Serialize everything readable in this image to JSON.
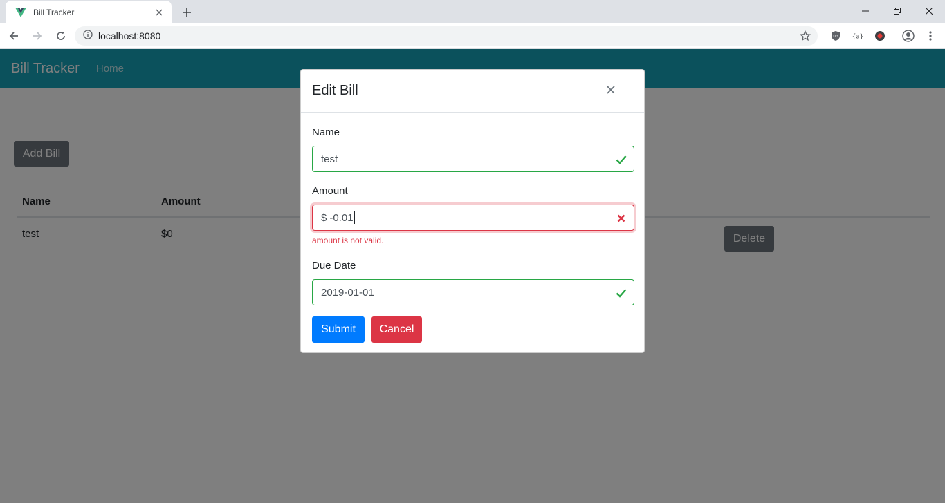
{
  "browser": {
    "tab_title": "Bill Tracker",
    "favicon_icon": "vue-logo-icon",
    "url": "localhost:8080",
    "extensions": [
      "ublock-icon",
      "json-formatter-icon",
      "extension-icon",
      "profile-icon",
      "menu-icon"
    ]
  },
  "navbar": {
    "brand": "Bill Tracker",
    "links": [
      "Home"
    ]
  },
  "page": {
    "add_bill_label": "Add Bill",
    "table": {
      "columns": [
        "Name",
        "Amount"
      ],
      "rows": [
        {
          "name": "test",
          "amount": "$0",
          "delete_label": "Delete"
        }
      ]
    }
  },
  "modal": {
    "title": "Edit Bill",
    "fields": {
      "name": {
        "label": "Name",
        "value": "test",
        "state": "valid"
      },
      "amount": {
        "label": "Amount",
        "prefix": "$",
        "value": "-0.01",
        "state": "invalid",
        "error": "amount is not valid."
      },
      "due_date": {
        "label": "Due Date",
        "value": "2019-01-01",
        "state": "valid"
      }
    },
    "submit_label": "Submit",
    "cancel_label": "Cancel"
  },
  "colors": {
    "navbar": "#17a2b8",
    "valid": "#28a745",
    "invalid": "#dc3545",
    "primary": "#007bff",
    "secondary": "#6c757d"
  }
}
